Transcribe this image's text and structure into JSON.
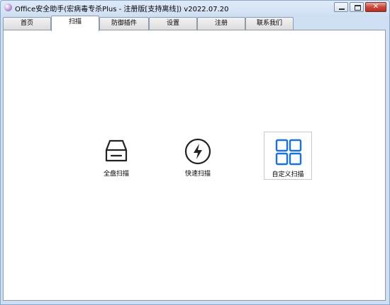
{
  "window": {
    "title": "Office安全助手(宏病毒专杀Plus - 注册版[支持离线]) v2022.07.20",
    "close_glyph": "✕"
  },
  "tabs": [
    {
      "label": "首页"
    },
    {
      "label": "扫描"
    },
    {
      "label": "防御插件"
    },
    {
      "label": "设置"
    },
    {
      "label": "注册"
    },
    {
      "label": "联系我们"
    }
  ],
  "active_tab": "扫描",
  "scan_options": [
    {
      "label": "全盘扫描",
      "icon": "drive-icon"
    },
    {
      "label": "快速扫描",
      "icon": "lightning-icon"
    },
    {
      "label": "自定义扫描",
      "icon": "grid-icon",
      "accent": "#1a73d9"
    }
  ]
}
